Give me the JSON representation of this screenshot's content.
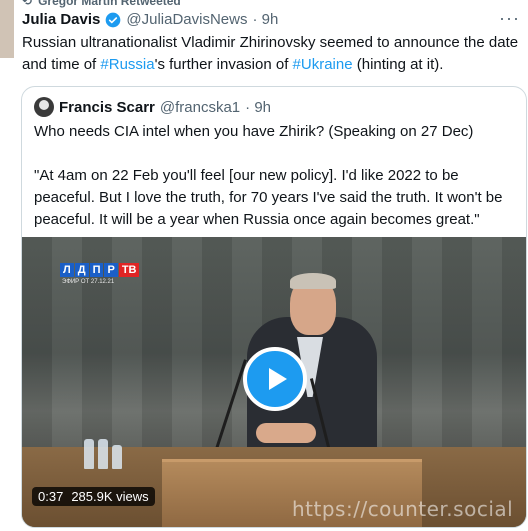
{
  "retweet": {
    "text": "Gregor Martin Retweeted"
  },
  "tweet": {
    "author_name": "Julia Davis",
    "author_handle": "@JuliaDavisNews",
    "time": "· 9h",
    "text_part1": "Russian ultranationalist Vladimir Zhirinovsky seemed to announce the date and time of ",
    "hashtag1": "#Russia",
    "text_part2": "'s further invasion of ",
    "hashtag2": "#Ukraine",
    "text_part3": " (hinting at it).",
    "more_icon": "more-icon"
  },
  "quote": {
    "author_name": "Francis Scarr",
    "author_handle": "@francska1",
    "time": "· 9h",
    "text": "Who needs CIA intel when you have Zhirik? (Speaking on 27 Dec)\n\n\"At 4am on 22 Feb you'll feel [our new policy]. I'd like 2022 to be peaceful. But I love the truth, for 70 years I've said the truth. It won't be peaceful. It will be a year when Russia once again becomes great.\""
  },
  "video": {
    "channel_logo_letters": [
      "Л",
      "Д",
      "П",
      "Р"
    ],
    "channel_logo_tv": "ТВ",
    "air_date": "ЭФИР ОТ 27.12.21",
    "duration": "0:37",
    "views": "285.9K views",
    "watermark": "https://counter.social",
    "play_color": "#1d9bf0"
  },
  "colors": {
    "link": "#1d9bf0",
    "muted": "#536471",
    "border": "#cfd9de"
  }
}
